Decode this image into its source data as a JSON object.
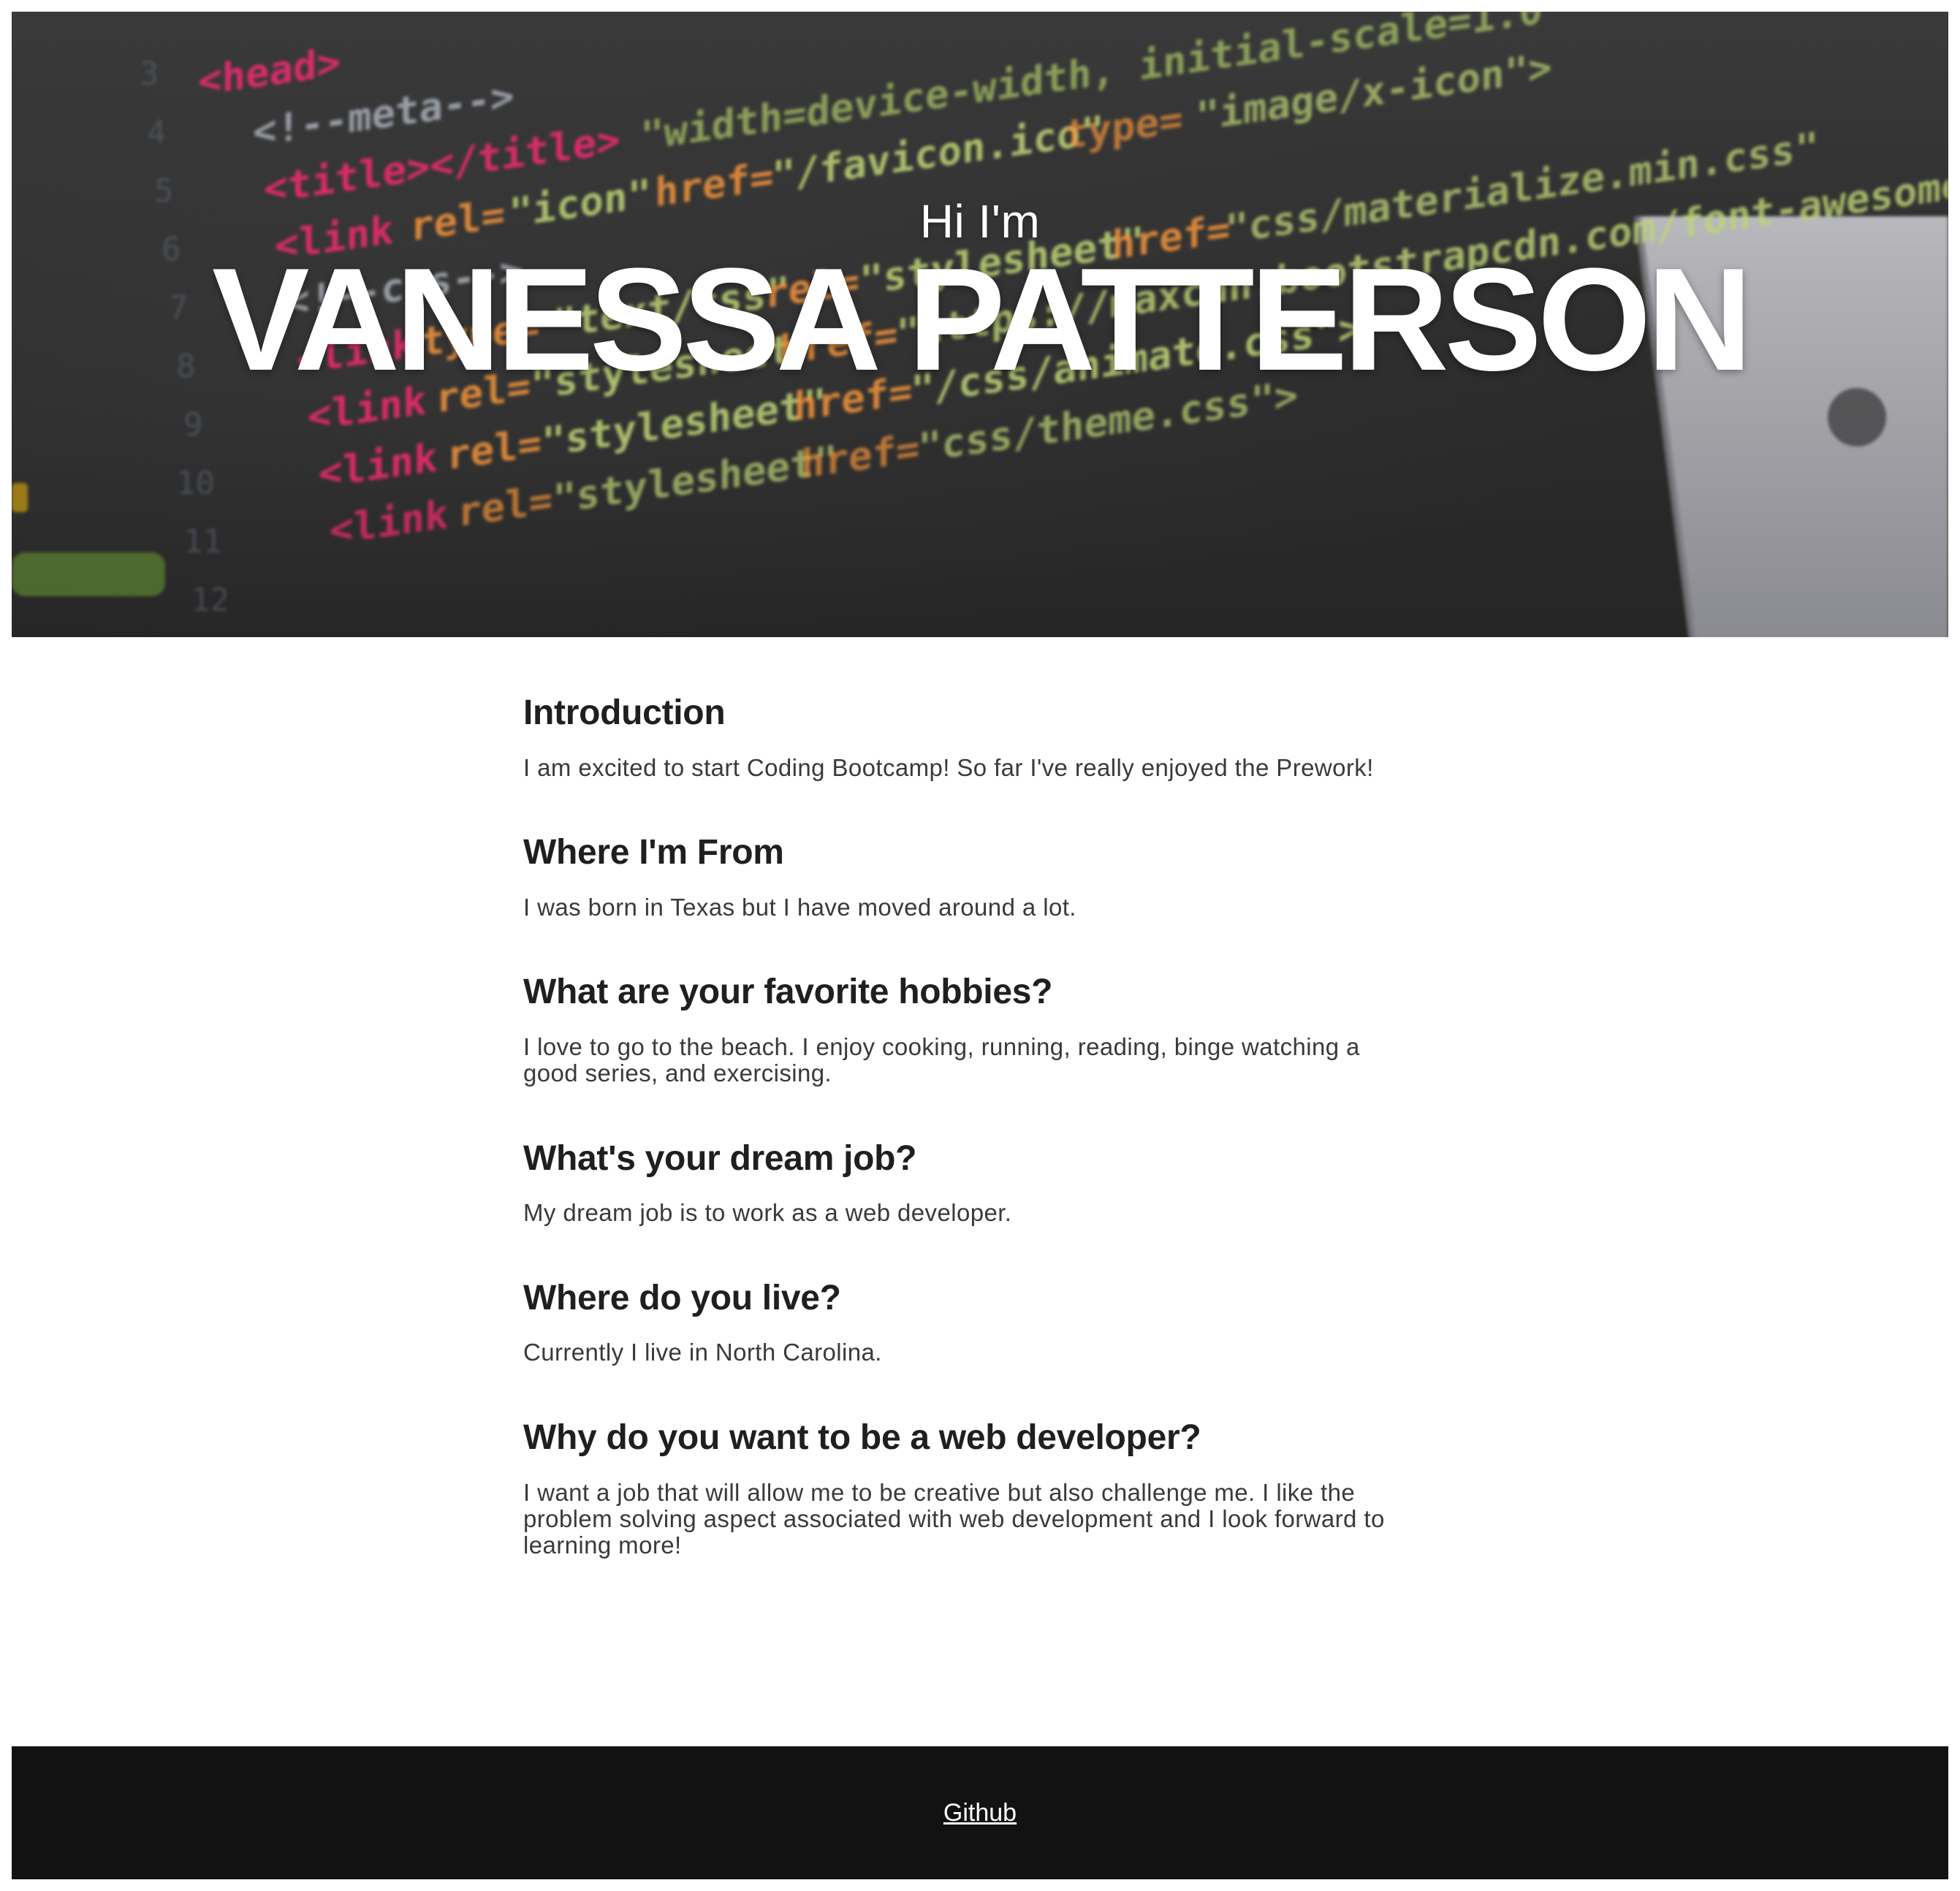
{
  "hero": {
    "greeting": "Hi I'm",
    "name": "VANESSA PATTERSON",
    "background_icon": "code-editor-background-photo"
  },
  "sections": [
    {
      "heading": "Introduction",
      "body": "I am excited to start Coding Bootcamp! So far I've really enjoyed the Prework!"
    },
    {
      "heading": "Where I'm From",
      "body": "I was born in Texas but I have moved around a lot."
    },
    {
      "heading": "What are your favorite hobbies?",
      "body": "I love to go to the beach. I enjoy cooking, running, reading, binge watching a good series, and exercising."
    },
    {
      "heading": "What's your dream job?",
      "body": "My dream job is to work as a web developer."
    },
    {
      "heading": "Where do you live?",
      "body": "Currently I live in North Carolina."
    },
    {
      "heading": "Why do you want to be a web developer?",
      "body": "I want a job that will allow me to be creative but also challenge me. I like the problem solving aspect associated with web development and I look forward to learning more!"
    }
  ],
  "footer": {
    "link_label": "Github"
  },
  "colors": {
    "hero_bg": "#2e2e2e",
    "footer_bg": "#121212",
    "heading": "#1f1f1f",
    "body_text": "#3a3a3a"
  }
}
